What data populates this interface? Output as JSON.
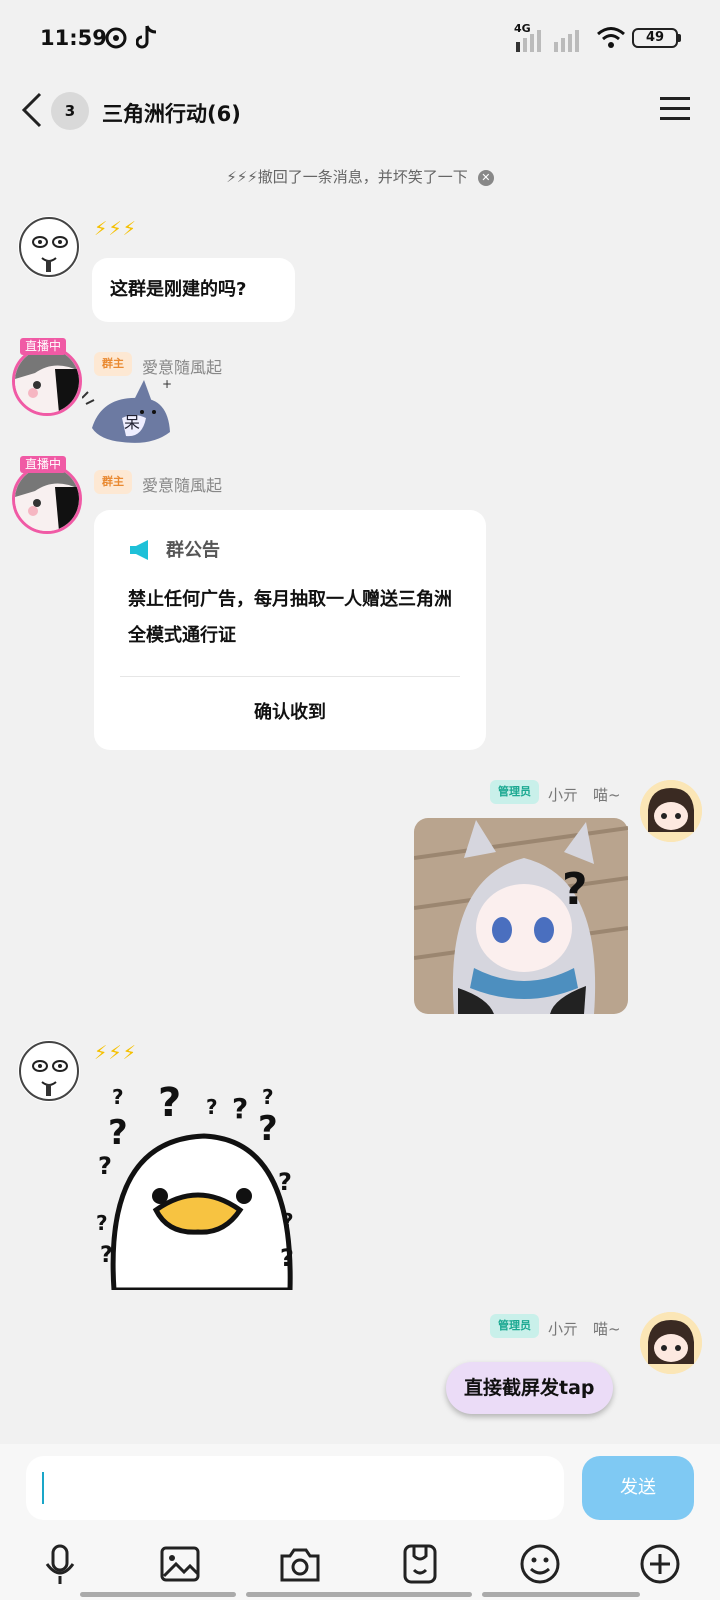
{
  "status": {
    "time": "11:59",
    "network": "4G",
    "battery": "49"
  },
  "header": {
    "unread": "3",
    "title": "三角洲行动(6)"
  },
  "recall_notice": "⚡⚡⚡撤回了一条消息，并坏笑了一下",
  "messages": [
    {
      "sender": "⚡⚡⚡",
      "text": "这群是刚建的吗?"
    },
    {
      "live": "直播中",
      "role": "群主",
      "sender": "愛意隨風起",
      "sticker": "shark-sticker"
    },
    {
      "live": "直播中",
      "role": "群主",
      "sender": "愛意隨風起",
      "notice": {
        "title": "群公告",
        "body": "禁止任何广告，每月抽取一人赠送三角洲全模式通行证",
        "confirm": "确认收到"
      }
    },
    {
      "role": "管理员",
      "sender": "小亓　喵~",
      "sticker": "catgirl-question-sticker"
    },
    {
      "sender": "⚡⚡⚡",
      "sticker": "duck-question-sticker"
    },
    {
      "role": "管理员",
      "sender": "小亓　喵~",
      "text": "直接截屏发tap"
    }
  ],
  "input": {
    "placeholder": "",
    "send_label": "发送"
  },
  "toolbar": [
    "mic-icon",
    "image-icon",
    "camera-icon",
    "file-icon",
    "emoji-icon",
    "plus-icon"
  ],
  "colors": {
    "send": "#7fc9f3",
    "live": "#f05aa5",
    "owner_badge": "#fde8d3",
    "admin_badge": "#c9f0ea",
    "reply_bubble": "#ebdcf7"
  }
}
